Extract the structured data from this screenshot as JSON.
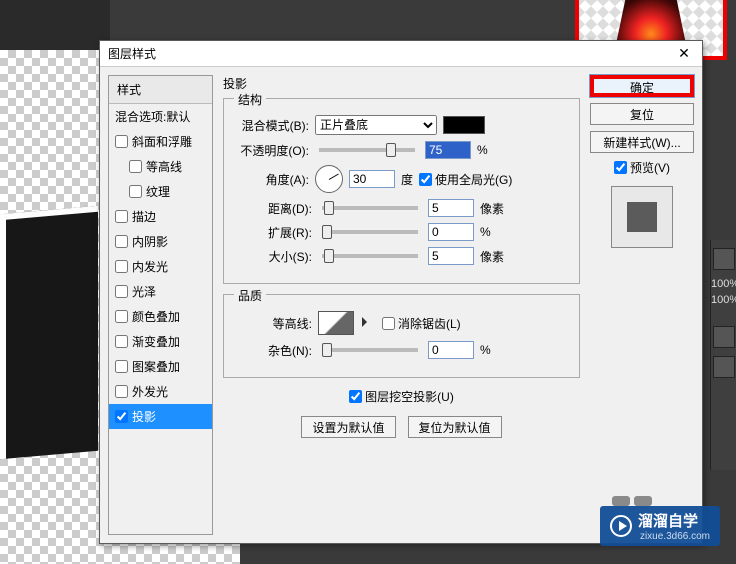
{
  "dialog": {
    "title": "图层样式",
    "close": "✕"
  },
  "styles": {
    "header": "样式",
    "blend_defaults": "混合选项:默认",
    "items": [
      {
        "label": "斜面和浮雕",
        "checked": false,
        "indent": false
      },
      {
        "label": "等高线",
        "checked": false,
        "indent": true
      },
      {
        "label": "纹理",
        "checked": false,
        "indent": true
      },
      {
        "label": "描边",
        "checked": false,
        "indent": false
      },
      {
        "label": "内阴影",
        "checked": false,
        "indent": false
      },
      {
        "label": "内发光",
        "checked": false,
        "indent": false
      },
      {
        "label": "光泽",
        "checked": false,
        "indent": false
      },
      {
        "label": "颜色叠加",
        "checked": false,
        "indent": false
      },
      {
        "label": "渐变叠加",
        "checked": false,
        "indent": false
      },
      {
        "label": "图案叠加",
        "checked": false,
        "indent": false
      },
      {
        "label": "外发光",
        "checked": false,
        "indent": false
      },
      {
        "label": "投影",
        "checked": true,
        "indent": false,
        "selected": true
      }
    ]
  },
  "shadow": {
    "panel_title": "投影",
    "structure_legend": "结构",
    "blend_mode_label": "混合模式(B):",
    "blend_mode_value": "正片叠底",
    "color": "#000000",
    "opacity_label": "不透明度(O):",
    "opacity_value": "75",
    "opacity_unit": "%",
    "angle_label": "角度(A):",
    "angle_value": "30",
    "angle_unit": "度",
    "global_light_label": "使用全局光(G)",
    "distance_label": "距离(D):",
    "distance_value": "5",
    "distance_unit": "像素",
    "spread_label": "扩展(R):",
    "spread_value": "0",
    "spread_unit": "%",
    "size_label": "大小(S):",
    "size_value": "5",
    "size_unit": "像素",
    "quality_legend": "品质",
    "contour_label": "等高线:",
    "antialias_label": "消除锯齿(L)",
    "noise_label": "杂色(N):",
    "noise_value": "0",
    "noise_unit": "%",
    "knockout_label": "图层挖空投影(U)",
    "make_default": "设置为默认值",
    "reset_default": "复位为默认值"
  },
  "right": {
    "ok": "确定",
    "cancel": "复位",
    "new_style": "新建样式(W)...",
    "preview": "预览(V)"
  },
  "side_panel": {
    "pct1": "100%",
    "pct2": "100%"
  },
  "watermark": {
    "brand": "溜溜自学",
    "url": "zixue.3d66.com"
  }
}
